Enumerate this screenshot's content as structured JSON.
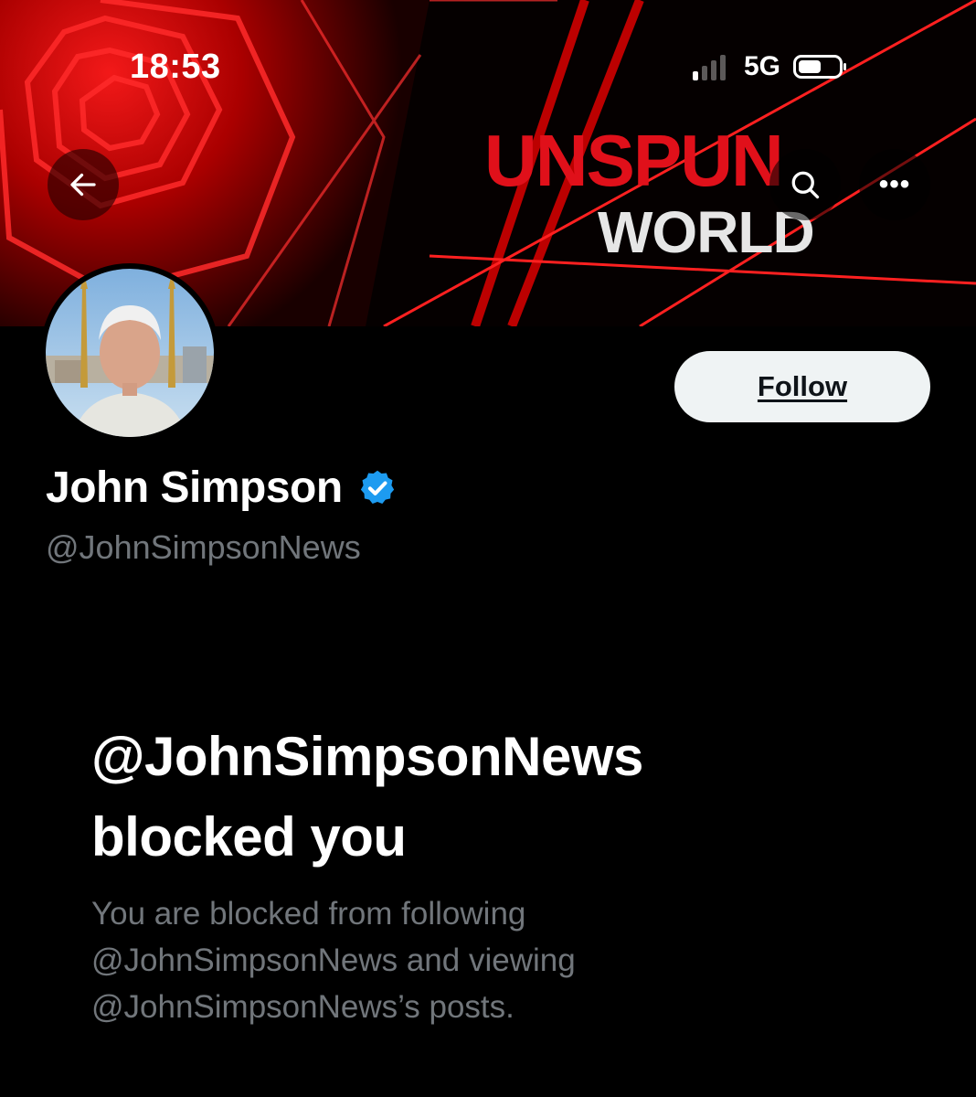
{
  "status_bar": {
    "time": "18:53",
    "network": "5G",
    "signal_bars_active": 1,
    "signal_bars_total": 4
  },
  "banner": {
    "brand_line1": "UNSPUN",
    "brand_line2": "WORLD",
    "colors": {
      "brand_red": "#e0101a",
      "background": "#050000"
    }
  },
  "nav": {
    "back_icon": "arrow-left-icon",
    "search_icon": "search-icon",
    "more_label": "•••",
    "more_icon": "more-horizontal-icon"
  },
  "profile": {
    "display_name": "John Simpson",
    "handle": "@JohnSimpsonNews",
    "verified": true,
    "verified_color": "#1d9bf0",
    "follow_label": "Follow"
  },
  "blocked_notice": {
    "title_line1": "@JohnSimpsonNews",
    "title_line2": "blocked you",
    "desc_line1": "You are blocked from following",
    "desc_line2": "@JohnSimpsonNews and viewing",
    "desc_line3": "@JohnSimpsonNews’s posts."
  }
}
